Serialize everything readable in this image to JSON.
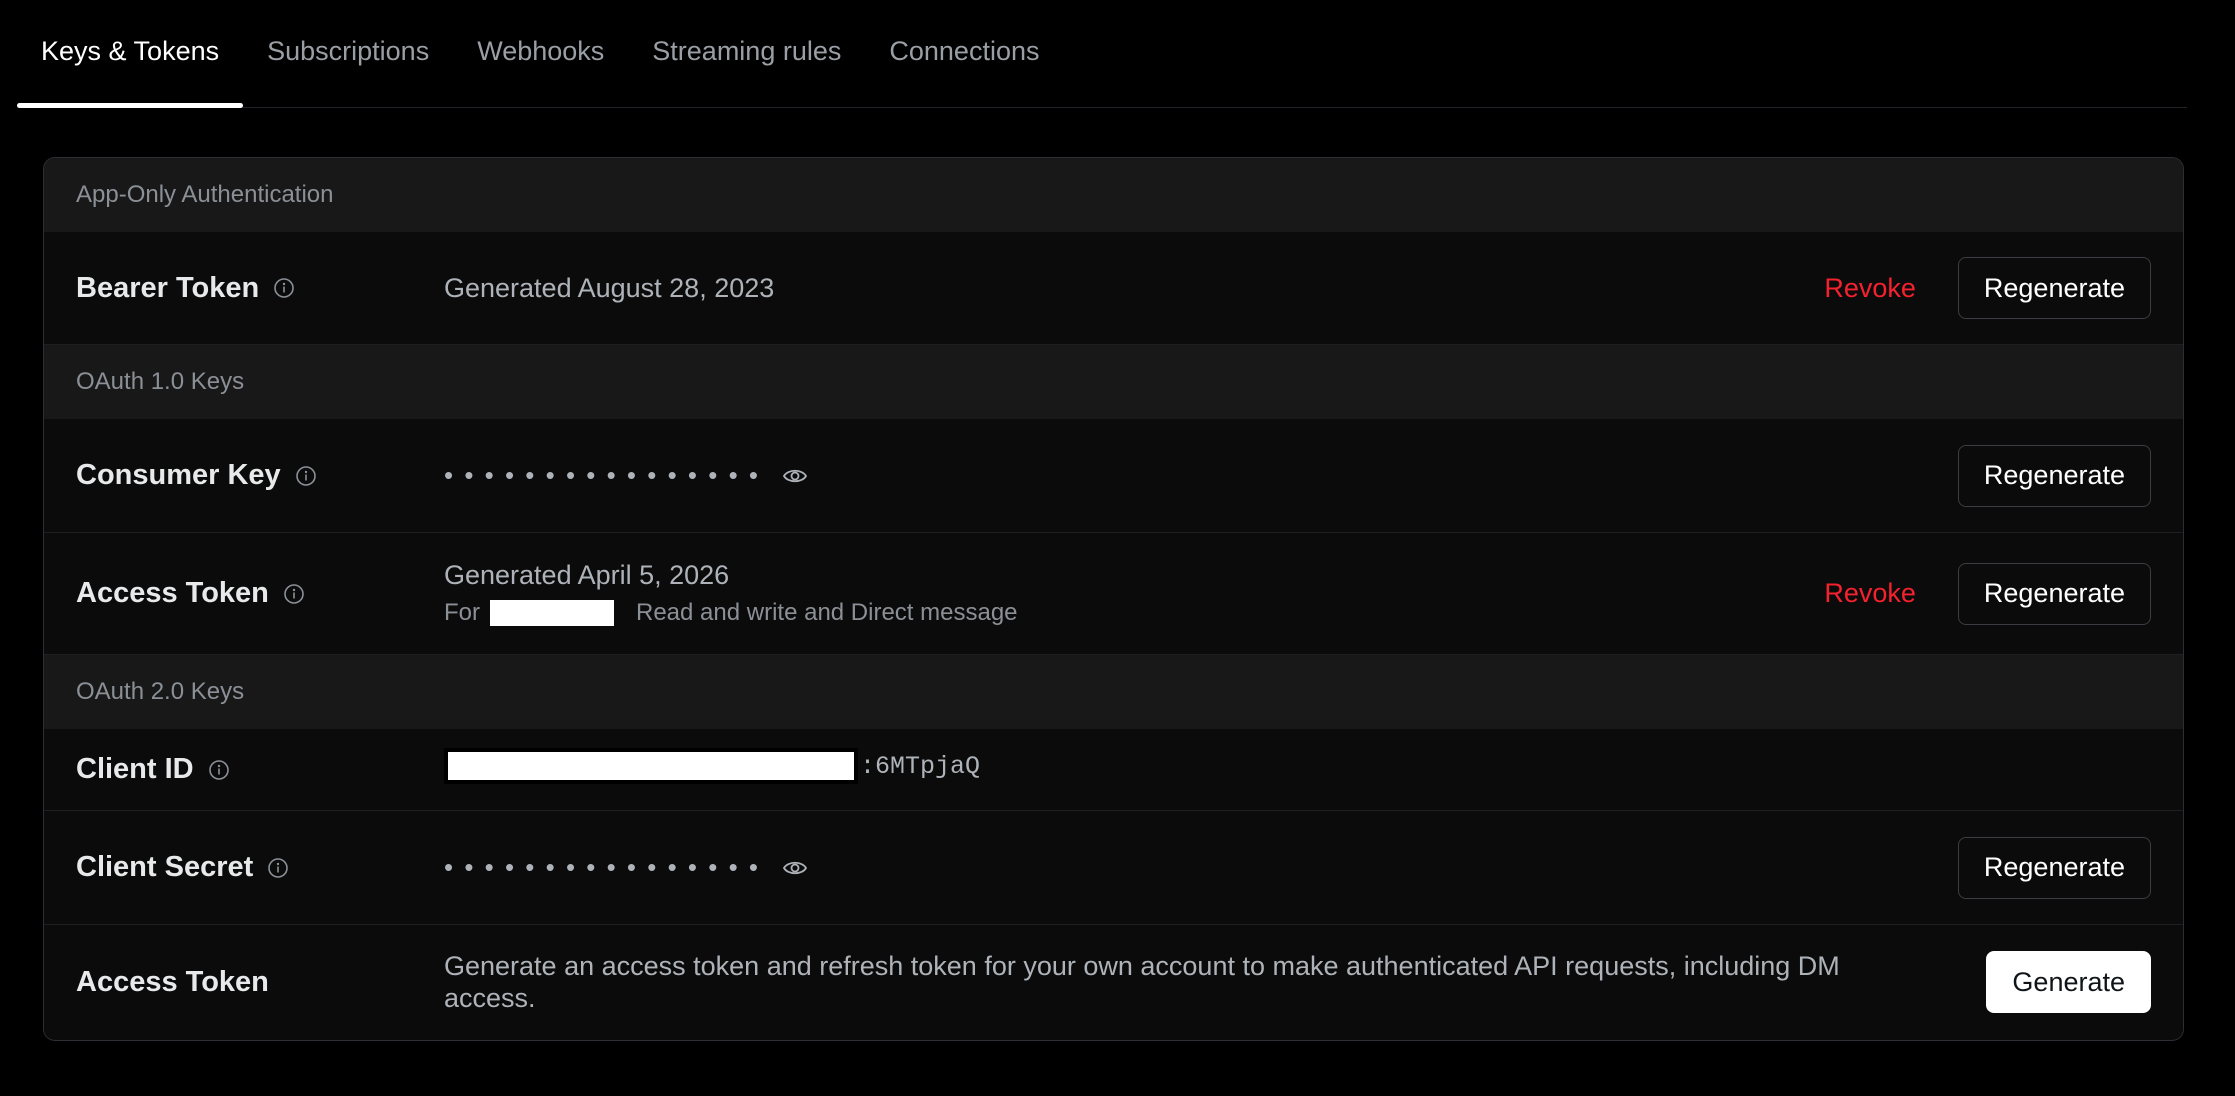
{
  "tabs": [
    {
      "label": "Keys & Tokens",
      "active": true
    },
    {
      "label": "Subscriptions",
      "active": false
    },
    {
      "label": "Webhooks",
      "active": false
    },
    {
      "label": "Streaming rules",
      "active": false
    },
    {
      "label": "Connections",
      "active": false
    }
  ],
  "sections": {
    "app_only": {
      "title": "App-Only Authentication",
      "bearer": {
        "label": "Bearer Token",
        "status": "Generated August 28, 2023",
        "revoke": "Revoke",
        "regenerate": "Regenerate"
      }
    },
    "oauth1": {
      "title": "OAuth 1.0 Keys",
      "consumer_key": {
        "label": "Consumer Key",
        "masked": "• • • • • • • • • • • • • • • •",
        "regenerate": "Regenerate"
      },
      "access_token": {
        "label": "Access Token",
        "status": "Generated April 5, 2026",
        "for_prefix": "For",
        "permissions": "Read and write and Direct message",
        "revoke": "Revoke",
        "regenerate": "Regenerate"
      }
    },
    "oauth2": {
      "title": "OAuth 2.0 Keys",
      "client_id": {
        "label": "Client ID",
        "visible_suffix": ":6MTpjaQ"
      },
      "client_secret": {
        "label": "Client Secret",
        "masked": "• • • • • • • • • • • • • • • •",
        "regenerate": "Regenerate"
      },
      "access_token": {
        "label": "Access Token",
        "description": "Generate an access token and refresh token for your own account to make authenticated API requests, including DM access.",
        "generate": "Generate"
      }
    }
  },
  "colors": {
    "background": "#000000",
    "danger": "#f4212e",
    "section_header_bg": "#181818"
  },
  "icons": [
    "info-icon",
    "eye-icon"
  ]
}
